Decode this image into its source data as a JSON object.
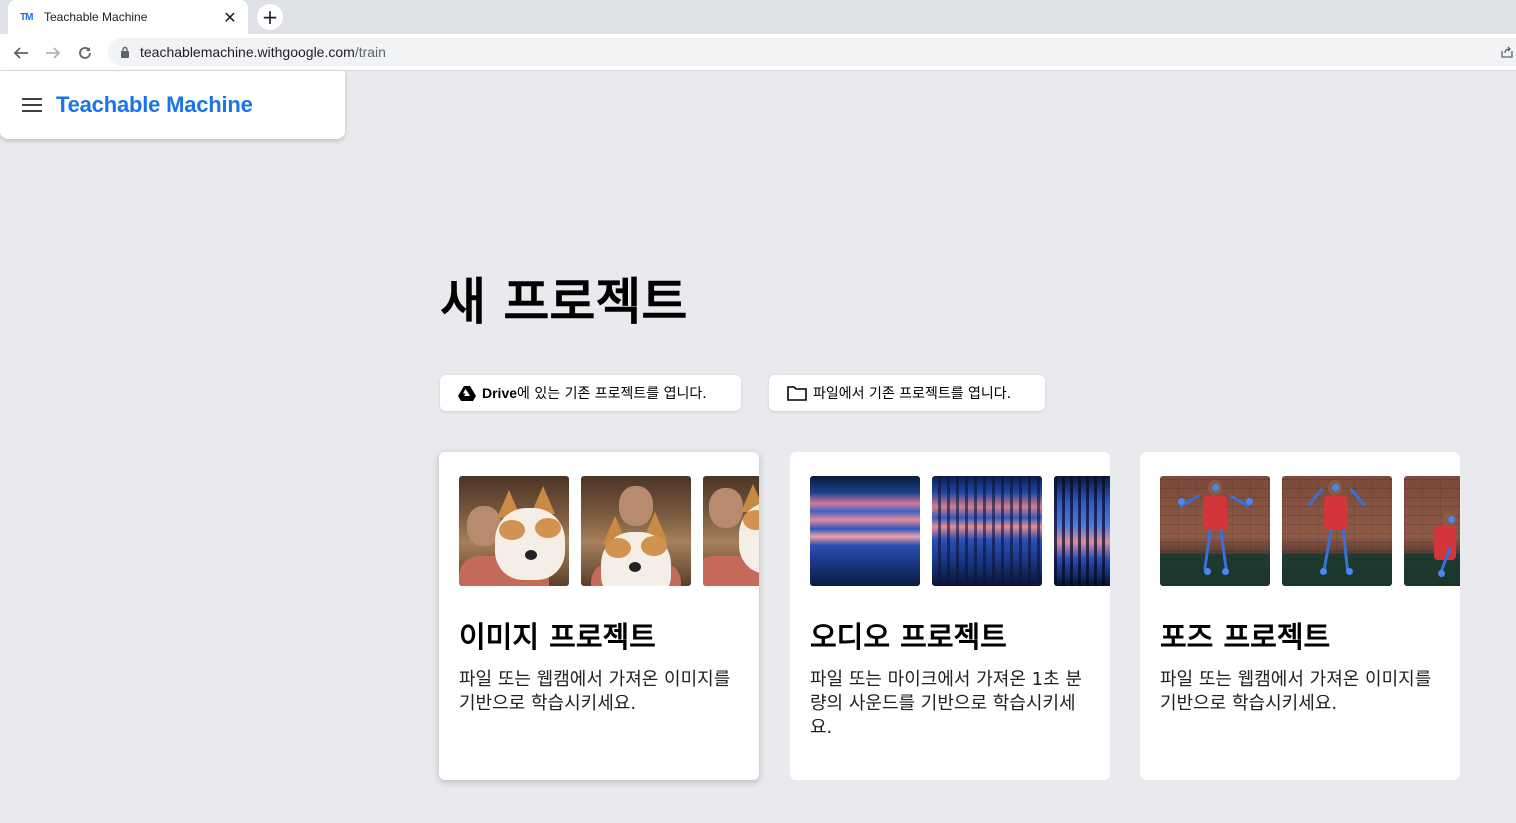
{
  "browser": {
    "tab_title": "Teachable Machine",
    "tab_favicon": "TM",
    "new_tab_label": "+",
    "url_domain": "teachablemachine.withgoogle.com",
    "url_path": "/train"
  },
  "app": {
    "brand": "Teachable Machine"
  },
  "main": {
    "title": "새 프로젝트",
    "open_drive": {
      "prefix": "Drive",
      "label": "에 있는 기존 프로젝트를 엽니다."
    },
    "open_file": {
      "label": "파일에서 기존 프로젝트를 엽니다."
    }
  },
  "cards": [
    {
      "title": "이미지 프로젝트",
      "description": "파일 또는 웹캠에서 가져온 이미지를 기반으로 학습시키세요."
    },
    {
      "title": "오디오 프로젝트",
      "description": "파일 또는 마이크에서 가져온 1초 분량의 사운드를 기반으로 학습시키세요."
    },
    {
      "title": "포즈 프로젝트",
      "description": "파일 또는 웹캠에서 가져온 이미지를 기반으로 학습시키세요."
    }
  ],
  "colors": {
    "brand": "#1a73e8",
    "page_background": "#e9eaed"
  }
}
